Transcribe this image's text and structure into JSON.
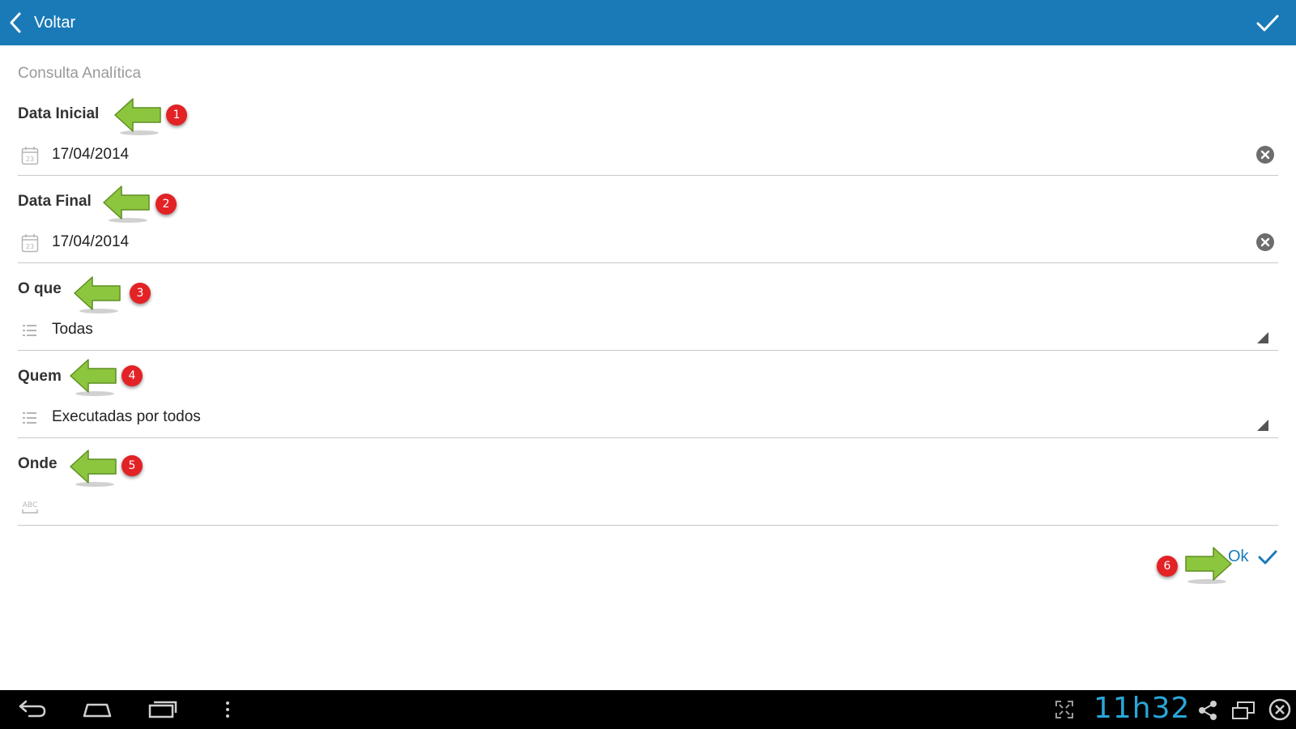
{
  "appbar": {
    "back_label": "Voltar",
    "accent": "#1a7ab8",
    "confirm_icon": "check-icon"
  },
  "page": {
    "subtitle": "Consulta Analítica"
  },
  "fields": [
    {
      "label": "Data Inicial",
      "value": "17/04/2014",
      "icon": "calendar-icon",
      "calendar_day": "23",
      "action": "clear-icon"
    },
    {
      "label": "Data Final",
      "value": "17/04/2014",
      "icon": "calendar-icon",
      "calendar_day": "23",
      "action": "clear-icon"
    },
    {
      "label": "O que",
      "value": "Todas",
      "icon": "list-icon",
      "action": "dropdown-arrow-icon"
    },
    {
      "label": "Quem",
      "value": "Executadas por todos",
      "icon": "list-icon",
      "action": "dropdown-arrow-icon"
    },
    {
      "label": "Onde",
      "value": "",
      "icon": "text-abc-icon",
      "icon_text": "ABC"
    }
  ],
  "annotations": {
    "badges": [
      "1",
      "2",
      "3",
      "4",
      "5",
      "6"
    ],
    "badge_color": "#e32226",
    "arrow_color": "#8cc63f"
  },
  "ok_button": {
    "label": "Ok"
  },
  "system_bar": {
    "clock": "11h32"
  }
}
